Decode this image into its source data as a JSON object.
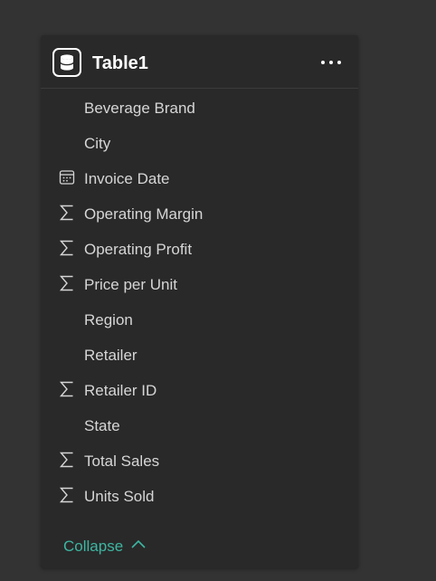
{
  "card": {
    "title": "Table1",
    "icons": {
      "table": "database-icon",
      "more": "more-horizontal-icon"
    }
  },
  "fields": [
    {
      "label": "Beverage Brand",
      "icon": ""
    },
    {
      "label": "City",
      "icon": ""
    },
    {
      "label": "Invoice Date",
      "icon": "calendar-icon"
    },
    {
      "label": "Operating Margin",
      "icon": "sigma-icon"
    },
    {
      "label": "Operating Profit",
      "icon": "sigma-icon"
    },
    {
      "label": "Price per Unit",
      "icon": "sigma-icon"
    },
    {
      "label": "Region",
      "icon": ""
    },
    {
      "label": "Retailer",
      "icon": ""
    },
    {
      "label": "Retailer ID",
      "icon": "sigma-icon"
    },
    {
      "label": "State",
      "icon": ""
    },
    {
      "label": "Total Sales",
      "icon": "sigma-icon"
    },
    {
      "label": "Units Sold",
      "icon": "sigma-icon"
    }
  ],
  "footer": {
    "collapse_label": "Collapse",
    "collapse_icon": "chevron-up-icon"
  },
  "colors": {
    "background": "#333333",
    "card": "#292929",
    "text": "#d6d6d6",
    "accent": "#3db6a2"
  }
}
